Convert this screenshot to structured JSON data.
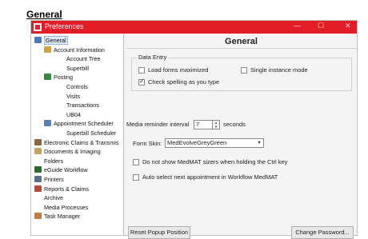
{
  "caption": "General",
  "window": {
    "title": "Preferences",
    "controls": [
      "—",
      "☐",
      "✕"
    ]
  },
  "sidebar": {
    "items": [
      {
        "label": "General",
        "icon": "settings-icon",
        "color": "#4a78c8",
        "level": 0,
        "selected": true
      },
      {
        "label": "Account Information",
        "icon": "account-icon",
        "color": "#d8a23a",
        "level": 1
      },
      {
        "label": "Account Tree",
        "level": 2
      },
      {
        "label": "Superbill",
        "level": 2
      },
      {
        "label": "Posting",
        "icon": "posting-icon",
        "color": "#2f8a3a",
        "level": 1
      },
      {
        "label": "Controls",
        "level": 2
      },
      {
        "label": "Visits",
        "level": 2
      },
      {
        "label": "Transactions",
        "level": 2
      },
      {
        "label": "UB04",
        "level": 2
      },
      {
        "label": "Appointment Scheduler",
        "icon": "calendar-icon",
        "color": "#5a7fbf",
        "level": 1
      },
      {
        "label": "Superbill Scheduler",
        "level": 2
      },
      {
        "label": "Electronic Claims & Transmis",
        "icon": "claims-icon",
        "color": "#8a6a3a",
        "level": 0
      },
      {
        "label": "Documents & Imaging",
        "icon": "documents-icon",
        "color": "#c9a25a",
        "level": 0
      },
      {
        "label": "Folders",
        "level": 1
      },
      {
        "label": "eGuide Workflow",
        "icon": "eguide-icon",
        "color": "#2d6a2d",
        "level": 0
      },
      {
        "label": "Printers",
        "icon": "printer-icon",
        "color": "#5b6e8a",
        "level": 0
      },
      {
        "label": "Reports & Claims",
        "icon": "reports-icon",
        "color": "#b84a3a",
        "level": 0
      },
      {
        "label": "Archive",
        "level": 1
      },
      {
        "label": "Media Processes",
        "level": 1
      },
      {
        "label": "Task Manager",
        "icon": "task-icon",
        "color": "#c77a3a",
        "level": 0
      }
    ]
  },
  "main": {
    "heading": "General",
    "data_entry": {
      "legend": "Data Entry",
      "load_forms_maximized": {
        "label": "Load forms maximized",
        "checked": false
      },
      "single_instance_mode": {
        "label": "Single instance mode",
        "checked": false
      },
      "check_spelling": {
        "label": "Check spelling as you type",
        "checked": true
      }
    },
    "media_reminder": {
      "label": "Media reminder interval",
      "value": "7",
      "unit": "seconds"
    },
    "form_skin": {
      "label": "Form Skin:",
      "value": "MedEvolveGreyGreen"
    },
    "no_sizers": {
      "label": "Do not show MedMAT sizers when holding the Ctrl key",
      "checked": false
    },
    "auto_select": {
      "label": "Auto select next appointment in Workflow MedMAT",
      "checked": false
    },
    "reset_button": "Reset Popup Position",
    "change_password_button": "Change Password..."
  }
}
